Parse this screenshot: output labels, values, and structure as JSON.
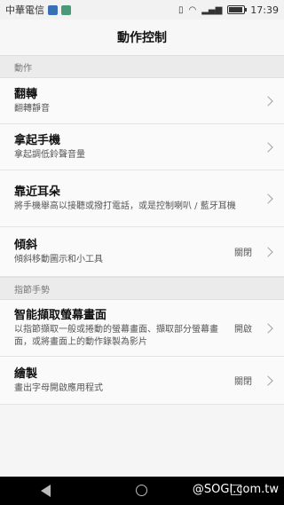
{
  "status_bar": {
    "carrier": "中華電信",
    "time": "17:39",
    "battery_level": 0.8
  },
  "title": "動作控制",
  "sections": [
    {
      "header": "動作",
      "items": [
        {
          "title": "翻轉",
          "subtitle": "翻轉靜音",
          "status": ""
        },
        {
          "title": "拿起手機",
          "subtitle": "拿起調低鈴聲音量",
          "status": ""
        },
        {
          "title": "靠近耳朵",
          "subtitle": "將手機舉高以接聽或撥打電話，或是控制喇叭 / 藍牙耳機",
          "status": ""
        },
        {
          "title": "傾斜",
          "subtitle": "傾斜移動圖示和小工具",
          "status": "關閉"
        }
      ]
    },
    {
      "header": "指節手勢",
      "items": [
        {
          "title": "智能擷取螢幕畫面",
          "subtitle": "以指節擷取一般或捲動的螢幕畫面、擷取部分螢幕畫面，或將畫面上的動作錄製為影片",
          "status": "開啟"
        },
        {
          "title": "繪製",
          "subtitle": "畫出字母開啟應用程式",
          "status": "關閉"
        }
      ]
    }
  ],
  "watermark": "@SOGI.com.tw",
  "colors": {
    "background": "#f5f5f5",
    "section_header_bg": "#ebebeb",
    "nav_bar": "#000000"
  }
}
